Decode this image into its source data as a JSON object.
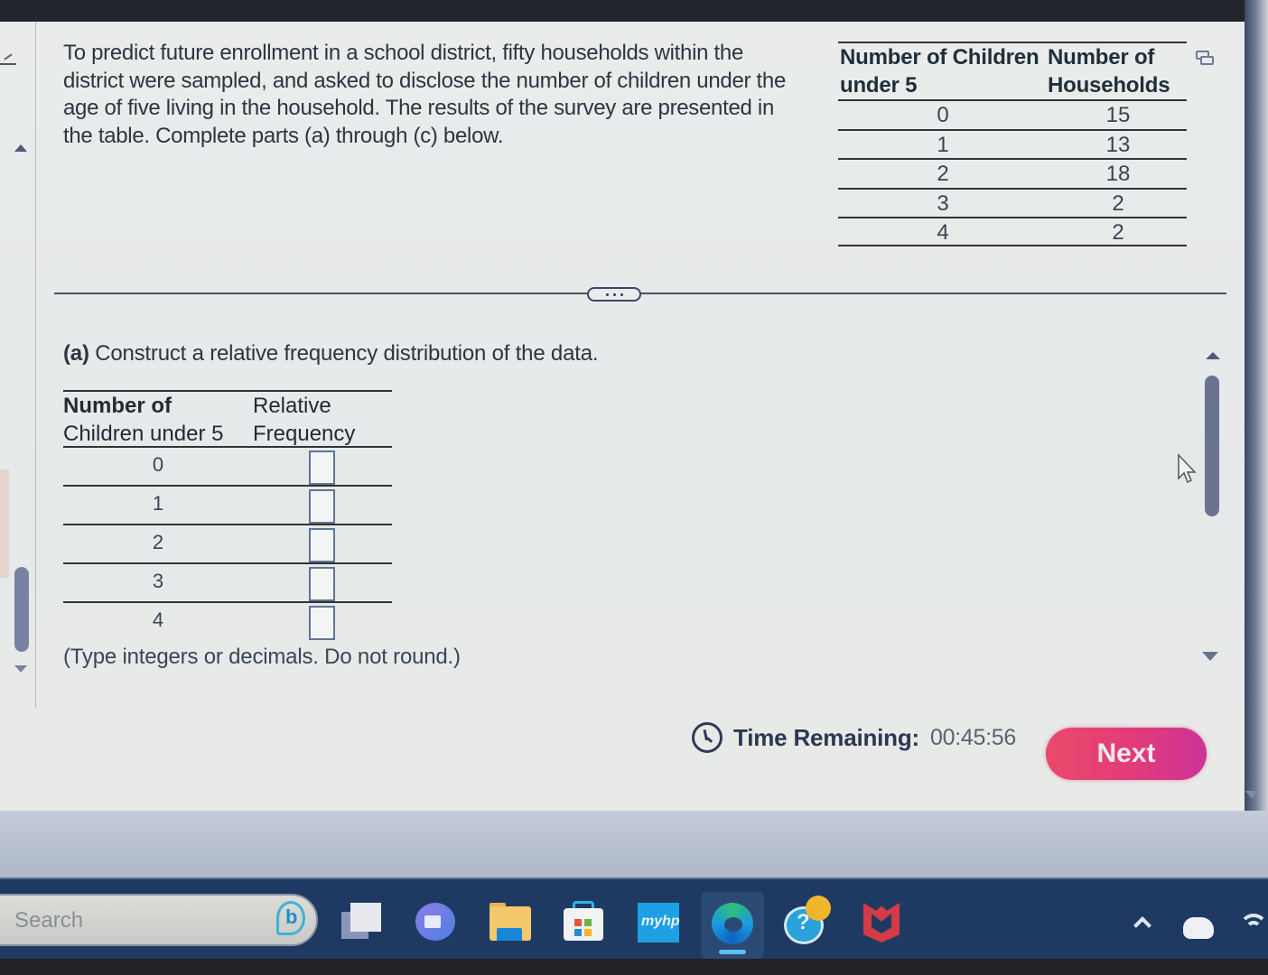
{
  "question": {
    "prompt": "To predict future enrollment in a school district, fifty households within the district were sampled, and asked to disclose the number of children under the age of five living in the household. The results of the survey are presented in the table. Complete parts (a) through (c) below.",
    "data_table": {
      "col1_header_line1": "Number of Children",
      "col1_header_line2": "under 5",
      "col2_header_line1": "Number of",
      "col2_header_line2": "Households",
      "rows": [
        {
          "children": "0",
          "households": "15"
        },
        {
          "children": "1",
          "households": "13"
        },
        {
          "children": "2",
          "households": "18"
        },
        {
          "children": "3",
          "households": "2"
        },
        {
          "children": "4",
          "households": "2"
        }
      ],
      "popout_icon": "popout-window-icon"
    },
    "divider_handle_icon": "more-horizontal-icon"
  },
  "part_a": {
    "label": "(a)",
    "instruction": "Construct a relative frequency distribution of the data.",
    "table": {
      "col1_header_line1": "Number of",
      "col1_header_line2": "Children under 5",
      "col2_header_line1": "Relative",
      "col2_header_line2": "Frequency",
      "rows": [
        {
          "children": "0",
          "value": ""
        },
        {
          "children": "1",
          "value": ""
        },
        {
          "children": "2",
          "value": ""
        },
        {
          "children": "3",
          "value": ""
        },
        {
          "children": "4",
          "value": ""
        }
      ]
    },
    "hint": "(Type integers or decimals. Do not round.)"
  },
  "footer": {
    "timer_label": "Time Remaining:",
    "timer_value": "00:45:56",
    "next_label": "Next",
    "next_color": "#e23b7a"
  },
  "taskbar": {
    "search_placeholder": "Search",
    "icons": [
      "bing-chat-icon",
      "task-view-icon",
      "meet-now-icon",
      "file-explorer-icon",
      "microsoft-store-icon",
      "myhp-icon",
      "edge-icon",
      "get-help-icon",
      "mcafee-icon"
    ],
    "hp_label": "myhp",
    "tray": [
      "show-hidden-icons-chevron",
      "onedrive-cloud-icon",
      "wifi-icon"
    ]
  }
}
